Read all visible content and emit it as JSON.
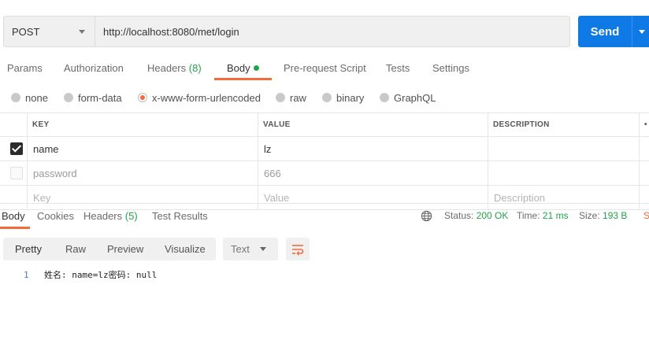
{
  "request": {
    "method": "POST",
    "url": "http://localhost:8080/met/login",
    "send_label": "Send"
  },
  "request_tabs": [
    {
      "label": "Params"
    },
    {
      "label": "Authorization"
    },
    {
      "label": "Headers",
      "count": "(8)"
    },
    {
      "label": "Body",
      "active": true,
      "indicator_color": "#26a14b"
    },
    {
      "label": "Pre-request Script"
    },
    {
      "label": "Tests"
    },
    {
      "label": "Settings"
    }
  ],
  "body_types": [
    {
      "label": "none"
    },
    {
      "label": "form-data"
    },
    {
      "label": "x-www-form-urlencoded",
      "selected": true
    },
    {
      "label": "raw"
    },
    {
      "label": "binary"
    },
    {
      "label": "GraphQL"
    }
  ],
  "params_table": {
    "headers": {
      "key": "KEY",
      "value": "VALUE",
      "description": "DESCRIPTION",
      "more": "•"
    },
    "rows": [
      {
        "checked": true,
        "key": "name",
        "value": "lz",
        "description": ""
      },
      {
        "checked": false,
        "key": "password",
        "value": "666",
        "description": ""
      }
    ],
    "placeholder": {
      "key": "Key",
      "value": "Value",
      "description": "Description"
    }
  },
  "response_tabs": [
    {
      "label": "Body",
      "active": true
    },
    {
      "label": "Cookies"
    },
    {
      "label": "Headers",
      "count": "(5)"
    },
    {
      "label": "Test Results"
    }
  ],
  "response_status": {
    "globe_icon": "globe-icon",
    "status_label": "Status:",
    "status_value": "200 OK",
    "time_label": "Time:",
    "time_value": "21 ms",
    "size_label": "Size:",
    "size_value": "193 B",
    "save_truncated": "S"
  },
  "response_view": {
    "modes": [
      "Pretty",
      "Raw",
      "Preview",
      "Visualize"
    ],
    "active_mode": "Pretty",
    "format": "Text",
    "wrap_icon": "wrap-lines-icon"
  },
  "response_body": {
    "lines": [
      {
        "number": "1",
        "text": "姓名: name=lz密码: null"
      }
    ]
  },
  "colors": {
    "accent": "#f26b3a",
    "send": "#0f7ae5",
    "success": "#26a14b"
  }
}
